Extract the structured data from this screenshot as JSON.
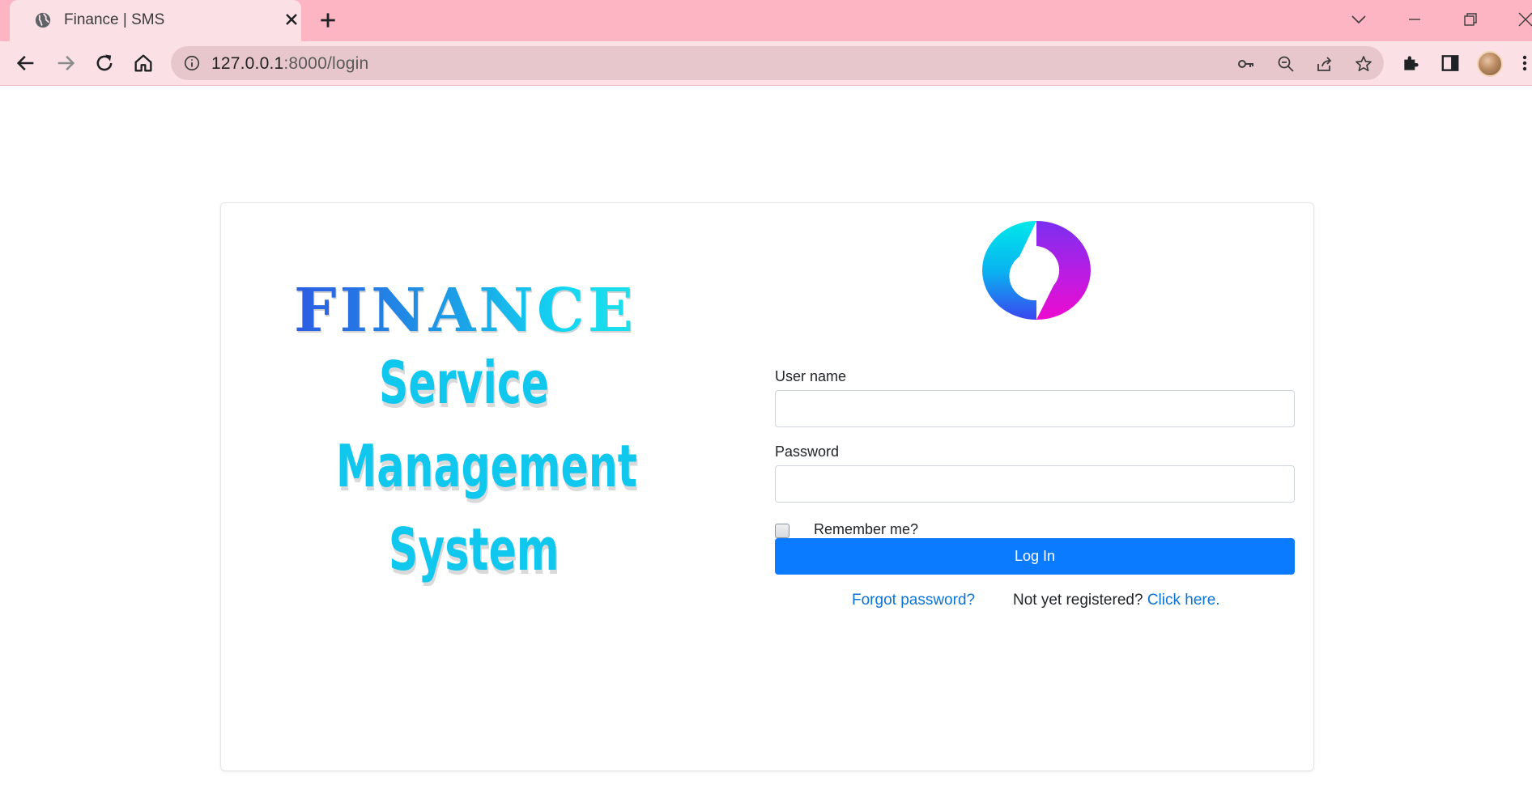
{
  "browser": {
    "tab_title": "Finance | SMS",
    "url_host": "127.0.0.1",
    "url_rest": ":8000/login",
    "icons": [
      "globe-icon",
      "close-icon",
      "plus-icon",
      "chevron-down-icon",
      "minimize-icon",
      "restore-icon",
      "window-close-icon",
      "back-icon",
      "forward-icon",
      "reload-icon",
      "home-icon",
      "info-icon",
      "key-icon",
      "zoom-out-icon",
      "share-icon",
      "star-icon",
      "extensions-icon",
      "side-panel-icon",
      "avatar",
      "menu-icon"
    ],
    "colors": {
      "tabbar": "#fdb4c3",
      "toolbar": "#fbe1e6",
      "omnibox": "#e7c7cc"
    }
  },
  "branding": {
    "finance": "FINANCE",
    "line1": "Service",
    "line2": "Management",
    "line3": "System",
    "colors": {
      "finance_start": "#2d5be3",
      "finance_end": "#1de0e8",
      "words": "#10c8ee"
    }
  },
  "login_form": {
    "username_label": "User name",
    "username_value": "",
    "password_label": "Password",
    "password_value": "",
    "remember_label": "Remember me?",
    "remember_checked": false,
    "login_button": "Log In",
    "forgot_link": "Forgot password?",
    "register_prompt": "Not yet registered?",
    "register_link": "Click here.",
    "colors": {
      "primary": "#0a7bff",
      "link": "#0b74d6"
    }
  }
}
